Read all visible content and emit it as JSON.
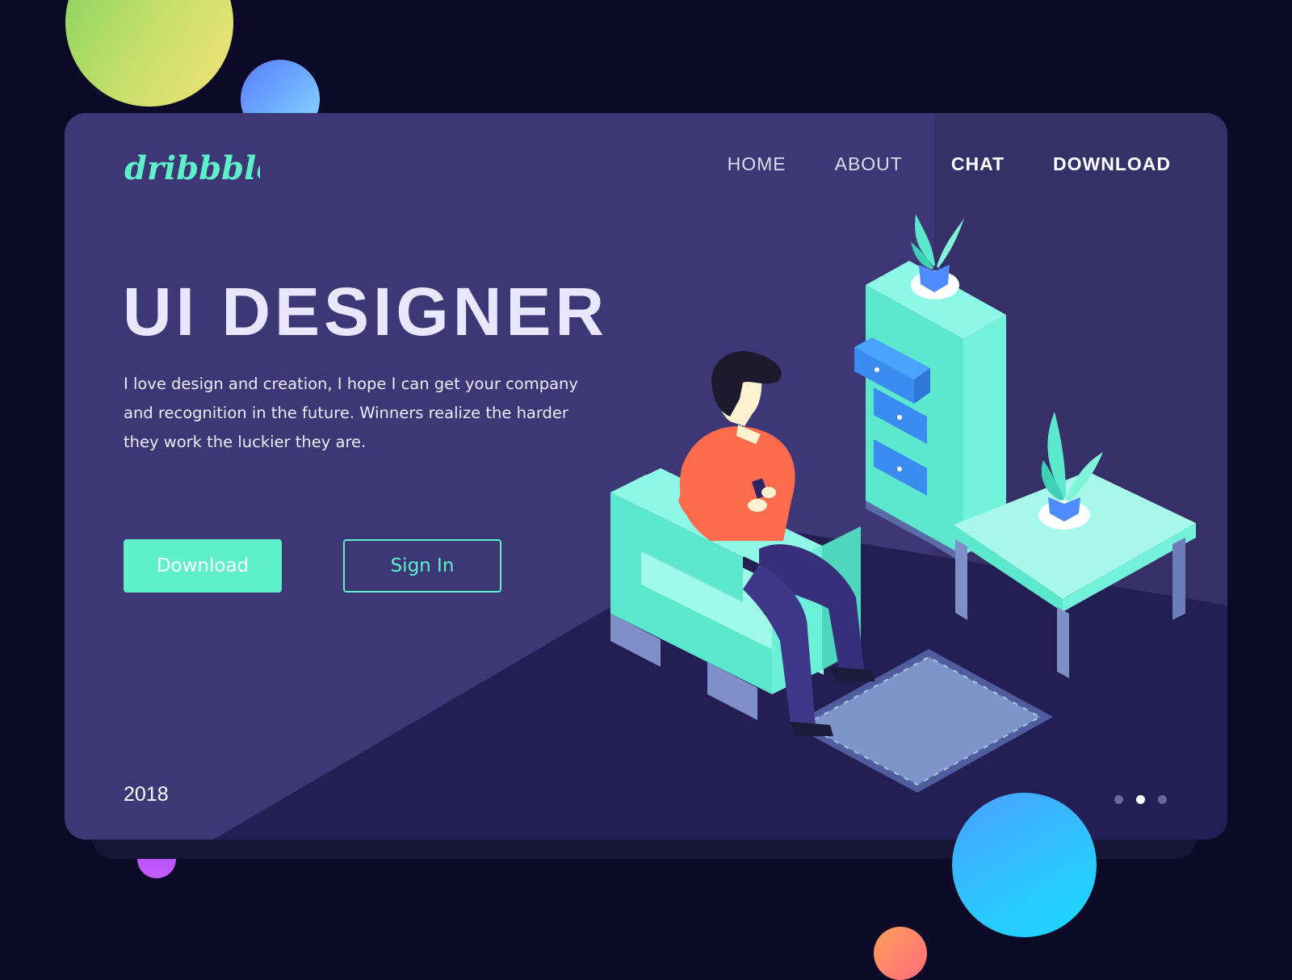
{
  "brand": {
    "logo_text": "dribbble"
  },
  "nav": {
    "items": [
      {
        "label": "HOME"
      },
      {
        "label": "ABOUT"
      },
      {
        "label": "CHAT"
      },
      {
        "label": "DOWNLOAD"
      }
    ]
  },
  "hero": {
    "title": "UI DESIGNER",
    "description": "I love design and creation, I hope I can get your company and recognition in the future. Winners realize the harder they work the luckier they are."
  },
  "buttons": {
    "primary_label": "Download",
    "secondary_label": "Sign In"
  },
  "footer": {
    "year": "2018"
  },
  "carousel": {
    "total": 3,
    "active_index": 1
  },
  "colors": {
    "page_bg": "#0c0a27",
    "card": "#3e3775",
    "floor": "#231e53",
    "accent": "#5ef0cb",
    "shirt": "#ff6b4d"
  }
}
